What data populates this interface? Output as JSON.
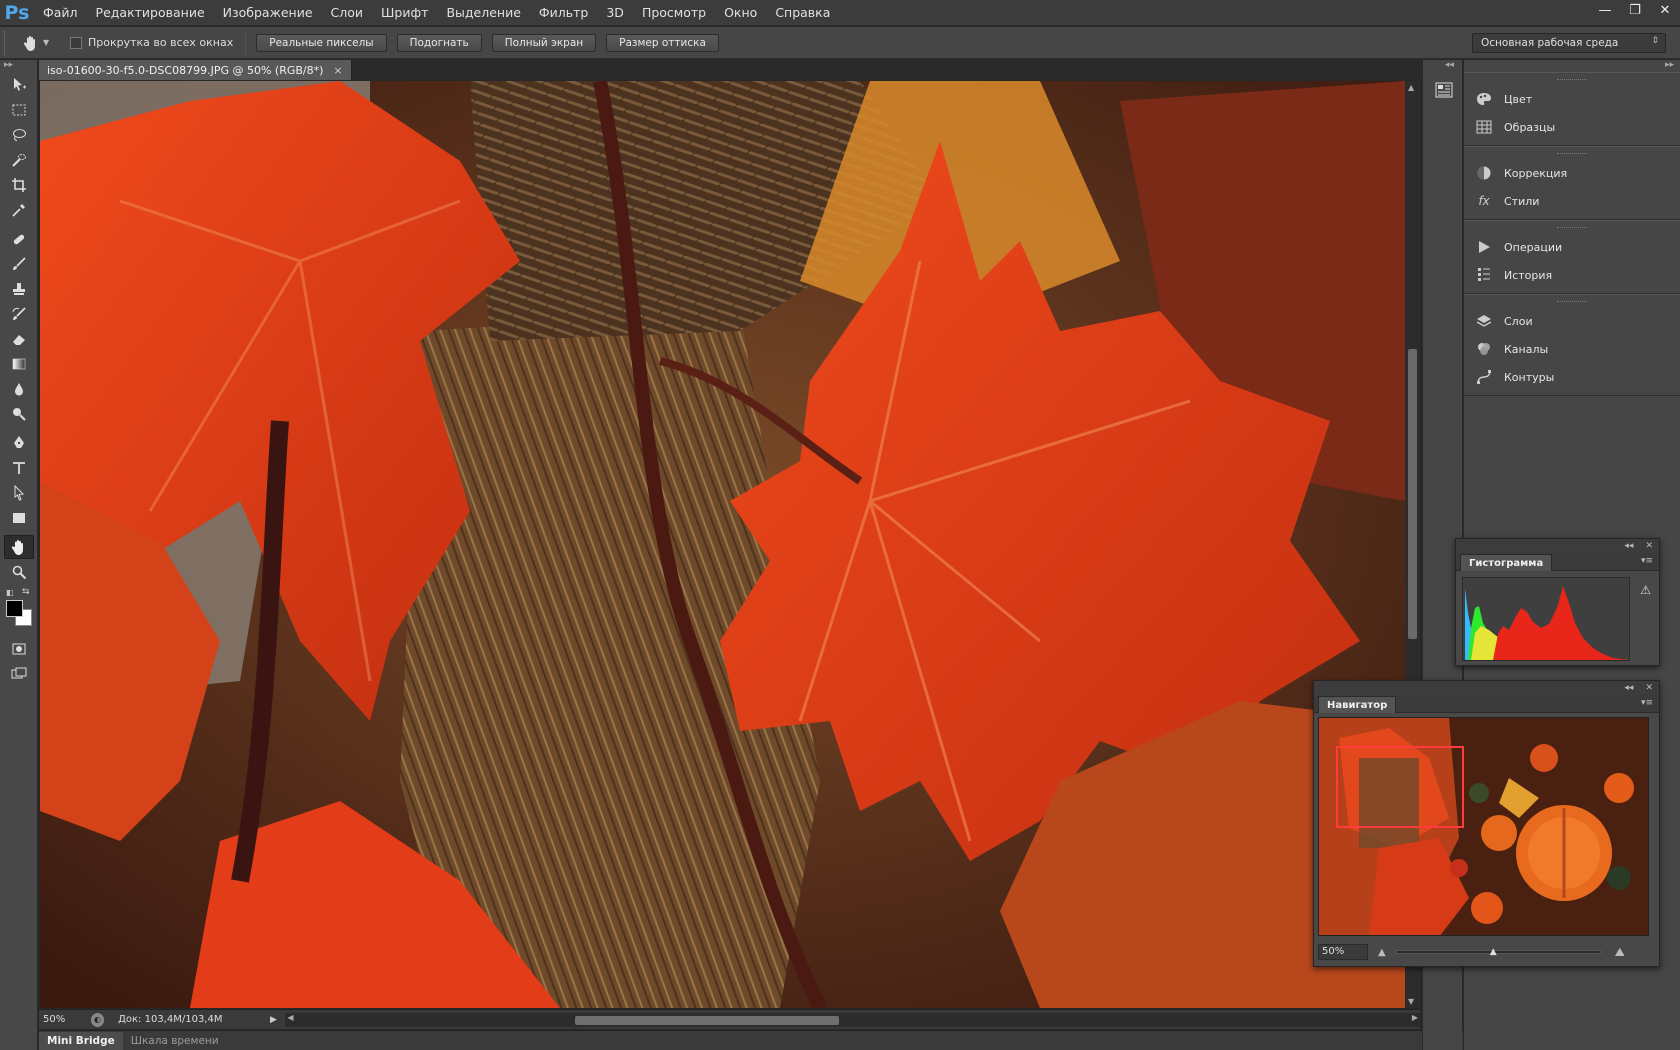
{
  "app": {
    "logo": "Ps"
  },
  "menu": [
    "Файл",
    "Редактирование",
    "Изображение",
    "Слои",
    "Шрифт",
    "Выделение",
    "Фильтр",
    "3D",
    "Просмотр",
    "Окно",
    "Справка"
  ],
  "window_controls": {
    "minimize": "—",
    "restore": "❐",
    "close": "✕"
  },
  "options": {
    "scroll_all_windows": "Прокрутка во всех окнах",
    "buttons": [
      "Реальные пикселы",
      "Подогнать",
      "Полный экран",
      "Размер оттиска"
    ],
    "workspace": "Основная рабочая среда"
  },
  "document": {
    "tab_title": "iso-01600-30-f5.0-DSC08799.JPG @ 50% (RGB/8*)",
    "close": "×"
  },
  "status": {
    "zoom": "50%",
    "doc_size": "Док: 103,4M/103,4M"
  },
  "bottom_tabs": [
    "Mini Bridge",
    "Шкала времени"
  ],
  "dock_groups": [
    {
      "items": [
        {
          "label": "Цвет",
          "icon": "palette-icon"
        },
        {
          "label": "Образцы",
          "icon": "swatches-icon"
        }
      ]
    },
    {
      "items": [
        {
          "label": "Коррекция",
          "icon": "adjustments-icon"
        },
        {
          "label": "Стили",
          "icon": "fx-icon"
        }
      ]
    },
    {
      "items": [
        {
          "label": "Операции",
          "icon": "play-icon"
        },
        {
          "label": "История",
          "icon": "history-icon"
        }
      ]
    },
    {
      "items": [
        {
          "label": "Слои",
          "icon": "layers-icon"
        },
        {
          "label": "Каналы",
          "icon": "channels-icon"
        },
        {
          "label": "Контуры",
          "icon": "paths-icon"
        }
      ]
    }
  ],
  "histogram_panel": {
    "title": "Гистограмма"
  },
  "navigator_panel": {
    "title": "Навигатор",
    "zoom": "50%"
  },
  "colors": {
    "foreground": "#000000",
    "background": "#ffffff",
    "nav_view_box": "#ff3b3b",
    "histogram_red": "#e8261a",
    "histogram_yellow": "#e5e537",
    "histogram_green": "#2ee82e",
    "histogram_blue": "#33bbff"
  }
}
